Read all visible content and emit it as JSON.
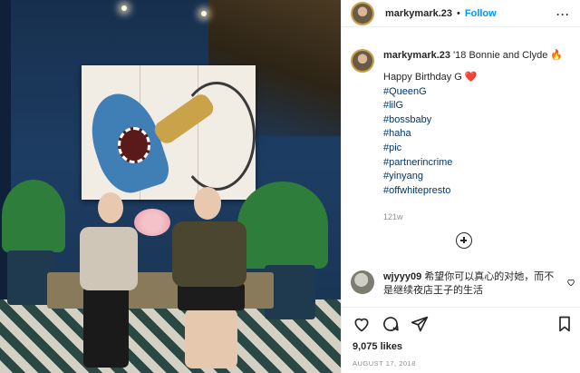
{
  "post": {
    "header": {
      "username": "markymark.23",
      "separator": "•",
      "follow_label": "Follow",
      "more_label": "···"
    },
    "caption": {
      "username": "markymark.23",
      "title": "'18 Bonnie and Clyde 🔥",
      "lines": [
        {
          "text": "Happy Birthday G ❤️",
          "type": "text"
        },
        {
          "text": "#QueenG",
          "type": "hashtag"
        },
        {
          "text": "#lilG",
          "type": "hashtag"
        },
        {
          "text": "#bossbaby",
          "type": "hashtag"
        },
        {
          "text": "#haha",
          "type": "hashtag"
        },
        {
          "text": "#pic",
          "type": "hashtag"
        },
        {
          "text": "#partnerincrime",
          "type": "hashtag"
        },
        {
          "text": "#yinyang",
          "type": "hashtag"
        },
        {
          "text": "#offwhitepresto",
          "type": "hashtag"
        }
      ],
      "time": "121w"
    },
    "load_more_icon": "plus-circle-icon",
    "comment": {
      "username": "wjyyy09",
      "text": "希望你可以真心的对她，而不是继续夜店王子的生活",
      "like_icon": "heart-outline-icon"
    },
    "actions": {
      "like_icon": "heart-outline-icon",
      "comment_icon": "comment-bubble-icon",
      "share_icon": "paper-plane-icon",
      "save_icon": "bookmark-icon"
    },
    "likes": "9,075 likes",
    "date": "AUGUST 17, 2018"
  },
  "colors": {
    "link": "#0095f6",
    "hashtag": "#00376b",
    "muted": "#8e8e8e",
    "text": "#262626"
  }
}
